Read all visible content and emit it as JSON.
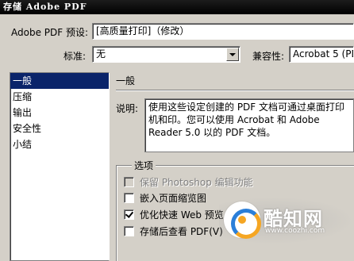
{
  "window": {
    "title": "存储 Adobe PDF"
  },
  "preset": {
    "label": "Adobe PDF 预设:",
    "value": "[高质量打印]（修改）"
  },
  "standard": {
    "label": "标准:",
    "value": "无"
  },
  "compat": {
    "label": "兼容性:",
    "value": "Acrobat 5 (PD"
  },
  "sidebar": {
    "items": [
      {
        "label": "一般",
        "selected": true
      },
      {
        "label": "压缩"
      },
      {
        "label": "输出"
      },
      {
        "label": "安全性"
      },
      {
        "label": "小结"
      }
    ]
  },
  "general": {
    "title": "一般",
    "description_label": "说明:",
    "description_text": "使用这些设定创建的 PDF 文档可通过桌面打印机和印。您可以使用 Acrobat 和 Adobe Reader 5.0 以的 PDF 文档。"
  },
  "options": {
    "title": "选项",
    "items": [
      {
        "label": "保留 Photoshop 编辑功能",
        "checked": false,
        "disabled": true
      },
      {
        "label": "嵌入页面缩览图",
        "checked": false,
        "disabled": false
      },
      {
        "label": "优化快速 Web 预览",
        "checked": true,
        "disabled": false
      },
      {
        "label": "存储后查看 PDF(V)",
        "checked": false,
        "disabled": false
      }
    ]
  },
  "watermark": {
    "name": "酷知网",
    "url": "www.coozhi.com"
  }
}
